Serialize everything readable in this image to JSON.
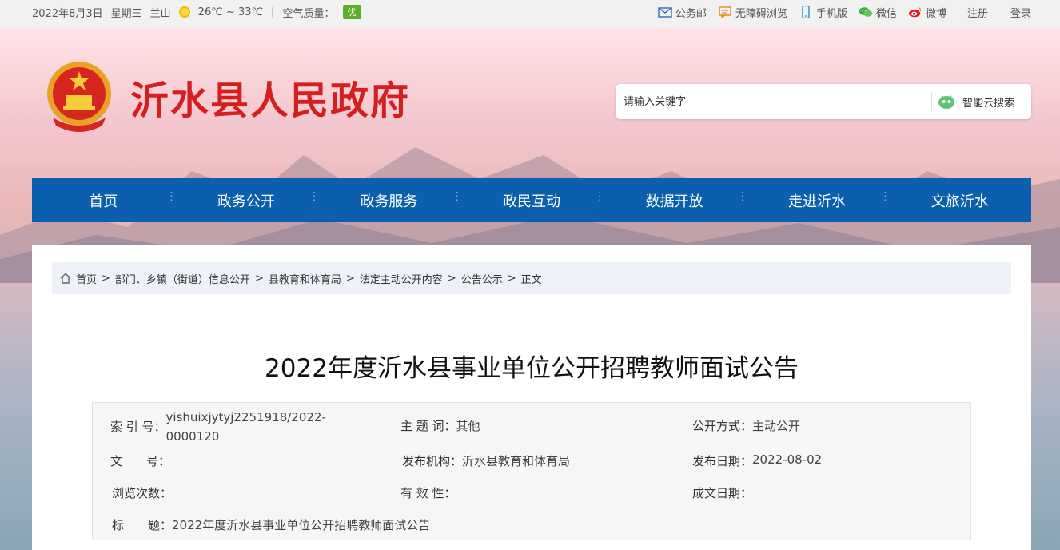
{
  "topbar": {
    "date": "2022年8月3日",
    "weekday": "星期三",
    "location": "兰山",
    "temperature": "26℃ ~ 33℃",
    "separator": "|",
    "air_quality_label": "空气质量：",
    "air_quality_value": "优",
    "links": [
      {
        "label": "公务邮",
        "icon": "mail-icon"
      },
      {
        "label": "无障碍浏览",
        "icon": "accessibility-icon"
      },
      {
        "label": "手机版",
        "icon": "mobile-icon"
      },
      {
        "label": "微信",
        "icon": "wechat-icon"
      },
      {
        "label": "微博",
        "icon": "weibo-icon"
      },
      {
        "label": "注册"
      },
      {
        "label": "登录"
      }
    ]
  },
  "header": {
    "site_title": "沂水县人民政府",
    "search_placeholder": "请输入关键字",
    "search_button": "智能云搜索"
  },
  "nav": {
    "items": [
      "首页",
      "政务公开",
      "政务服务",
      "政民互动",
      "数据开放",
      "走进沂水",
      "文旅沂水"
    ],
    "separator": "⋮"
  },
  "breadcrumb": {
    "items": [
      "首页",
      "部门、乡镇（街道）信息公开",
      "县教育和体育局",
      "法定主动公开内容",
      "公告公示",
      "正文"
    ],
    "separator": ">"
  },
  "article": {
    "title": "2022年度沂水县事业单位公开招聘教师面试公告"
  },
  "meta": {
    "index_label": "索 引 号：",
    "index_value_line1": "yishuixjytyj2251918/2022-",
    "index_value_line2": "0000120",
    "subject_label": "主 题 词：",
    "subject_value": "其他",
    "disclosure_label": "公开方式：",
    "disclosure_value": "主动公开",
    "docno_label": "文　　号：",
    "docno_value": "",
    "publisher_label": "发布机构：",
    "publisher_value": "沂水县教育和体育局",
    "pubdate_label": "发布日期：",
    "pubdate_value": "2022-08-02",
    "views_label": "浏览次数：",
    "views_value": "",
    "validity_label": "有 效 性：",
    "validity_value": "",
    "created_label": "成文日期：",
    "created_value": "",
    "title_label": "标　　题：",
    "title_value": "2022年度沂水县事业单位公开招聘教师面试公告"
  },
  "colors": {
    "nav_bg": "#0c5fae",
    "title_red": "#d3201e",
    "aq_green": "#5ab126"
  }
}
